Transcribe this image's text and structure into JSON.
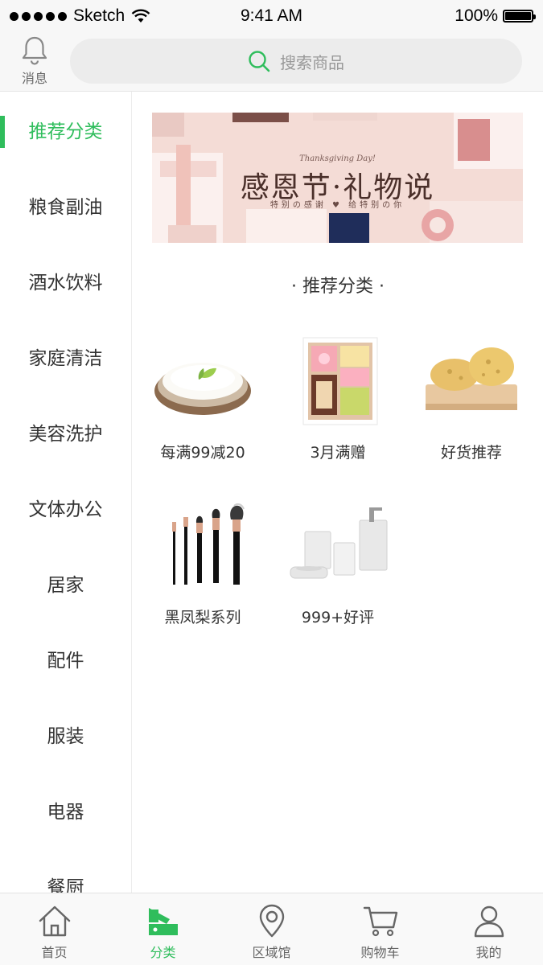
{
  "status_bar": {
    "carrier": "Sketch",
    "time": "9:41 AM",
    "battery": "100%"
  },
  "header": {
    "messages_label": "消息",
    "search_placeholder": "搜索商品"
  },
  "sidebar": {
    "items": [
      {
        "label": "推荐分类",
        "active": true
      },
      {
        "label": "粮食副油",
        "active": false
      },
      {
        "label": "酒水饮料",
        "active": false
      },
      {
        "label": "家庭清洁",
        "active": false
      },
      {
        "label": "美容洗护",
        "active": false
      },
      {
        "label": "文体办公",
        "active": false
      },
      {
        "label": "居家",
        "active": false
      },
      {
        "label": "配件",
        "active": false
      },
      {
        "label": "服装",
        "active": false
      },
      {
        "label": "电器",
        "active": false
      },
      {
        "label": "餐厨",
        "active": false
      }
    ]
  },
  "banner": {
    "subtitle": "Thanksgiving Day!",
    "title": "感恩节·礼物说",
    "tagline": "特别の感谢 ♥ 给特别の你"
  },
  "section": {
    "title": "· 推荐分类 ·"
  },
  "categories": [
    {
      "label": "每满99减20",
      "icon": "rice-bowl-image"
    },
    {
      "label": "3月满赠",
      "icon": "gift-box-image"
    },
    {
      "label": "好货推荐",
      "icon": "sponge-image"
    },
    {
      "label": "黑凤梨系列",
      "icon": "makeup-brush-image"
    },
    {
      "label": "999+好评",
      "icon": "bathroom-set-image"
    }
  ],
  "tabbar": {
    "items": [
      {
        "label": "首页",
        "icon": "home-icon",
        "active": false
      },
      {
        "label": "分类",
        "icon": "category-icon",
        "active": true
      },
      {
        "label": "区域馆",
        "icon": "location-pin-icon",
        "active": false
      },
      {
        "label": "购物车",
        "icon": "cart-icon",
        "active": false
      },
      {
        "label": "我的",
        "icon": "user-icon",
        "active": false
      }
    ]
  },
  "colors": {
    "accent": "#2fbd5c",
    "text": "#333333",
    "muted": "#999999"
  }
}
